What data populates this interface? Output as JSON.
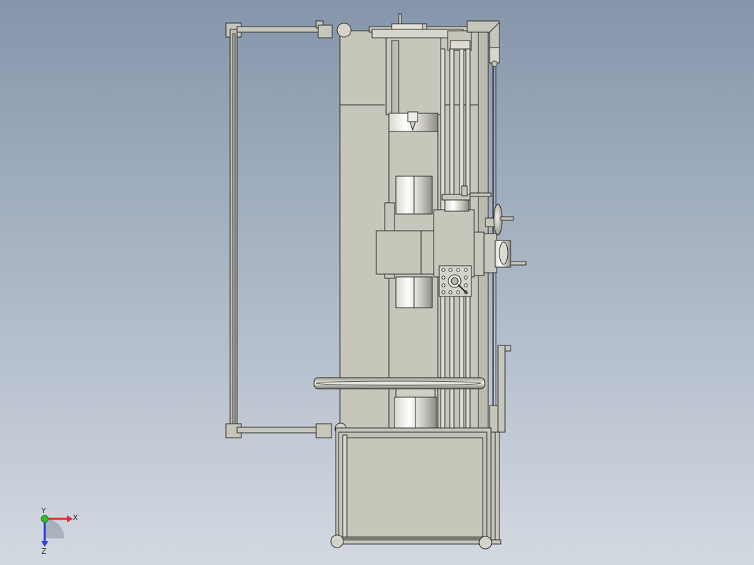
{
  "viewport": {
    "background_top": "#8596ab",
    "background_bottom": "#d3d9e1",
    "part_fill": "#c7c6bb",
    "part_shadow": "#a9a89c",
    "edge_color": "#2a2a2a"
  },
  "triad": {
    "x_label": "X",
    "y_label": "Y",
    "z_label": "Z",
    "x_color": "#e8282a",
    "y_color": "#2bbf2b",
    "z_color": "#2a3fd6"
  }
}
